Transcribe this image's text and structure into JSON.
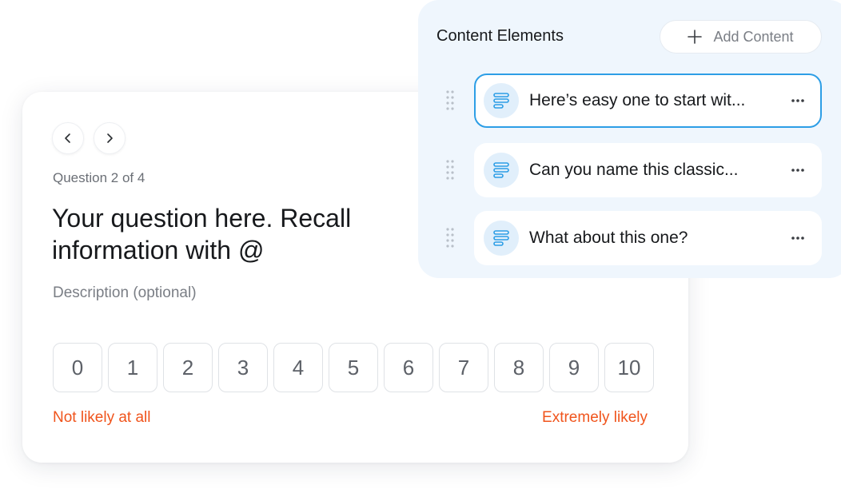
{
  "survey": {
    "counter": "Question 2 of 4",
    "title": "Your question here. Recall information with @",
    "description": "Description (optional)",
    "scale": [
      "0",
      "1",
      "2",
      "3",
      "4",
      "5",
      "6",
      "7",
      "8",
      "9",
      "10"
    ],
    "low_label": "Not likely at all",
    "high_label": "Extremely likely",
    "accent_color": "#f0541c"
  },
  "panel": {
    "title": "Content Elements",
    "add_label": "Add Content",
    "selected_color": "#2d9ee6",
    "items": [
      {
        "label": "Here’s easy one to start wit...",
        "icon": "text-lines-icon",
        "selected": true
      },
      {
        "label": "Can you name this classic...",
        "icon": "text-lines-icon",
        "selected": false
      },
      {
        "label": "What about this one?",
        "icon": "text-lines-icon",
        "selected": false
      }
    ]
  }
}
